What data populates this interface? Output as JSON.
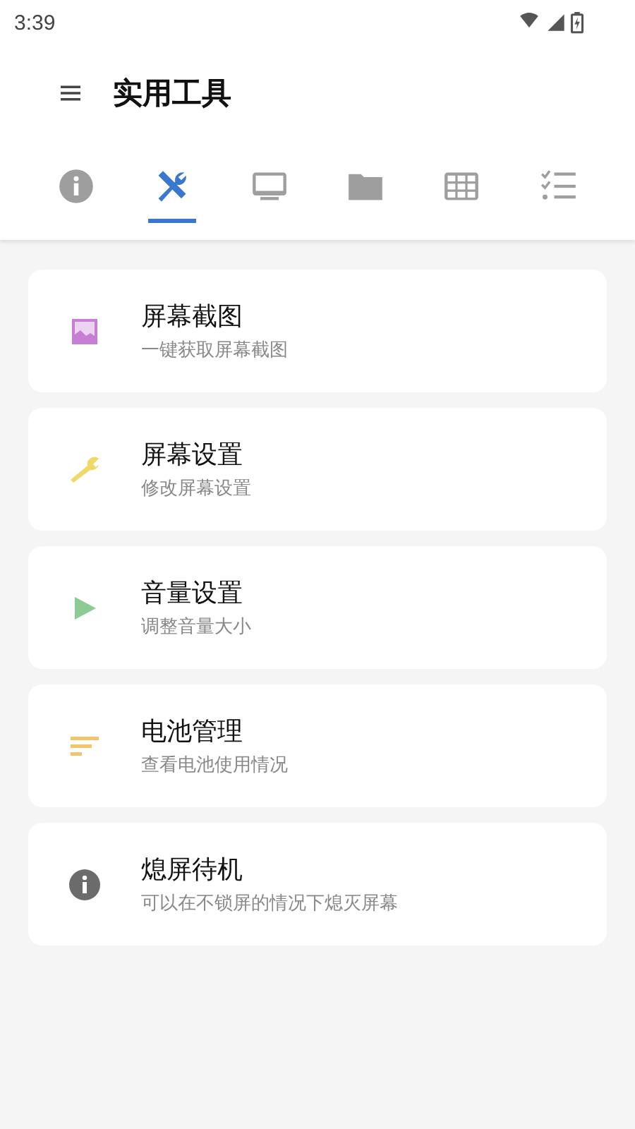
{
  "status_bar": {
    "time": "3:39"
  },
  "app_bar": {
    "title": "实用工具"
  },
  "tabs": [
    {
      "kind": "info",
      "selected": false
    },
    {
      "kind": "tools",
      "selected": true
    },
    {
      "kind": "monitor",
      "selected": false
    },
    {
      "kind": "folder",
      "selected": false
    },
    {
      "kind": "grid",
      "selected": false
    },
    {
      "kind": "checklist",
      "selected": false
    }
  ],
  "items": [
    {
      "kind": "image",
      "color": "#c77fd6",
      "title": "屏幕截图",
      "subtitle": "一键获取屏幕截图"
    },
    {
      "kind": "wrench",
      "color": "#f0d86a",
      "title": "屏幕设置",
      "subtitle": "修改屏幕设置"
    },
    {
      "kind": "play",
      "color": "#8ccb94",
      "title": "音量设置",
      "subtitle": "调整音量大小"
    },
    {
      "kind": "bars",
      "color": "#f3c56b",
      "title": "电池管理",
      "subtitle": "查看电池使用情况"
    },
    {
      "kind": "info",
      "color": "#6b6b6b",
      "title": "熄屏待机",
      "subtitle": "可以在不锁屏的情况下熄灭屏幕"
    }
  ]
}
